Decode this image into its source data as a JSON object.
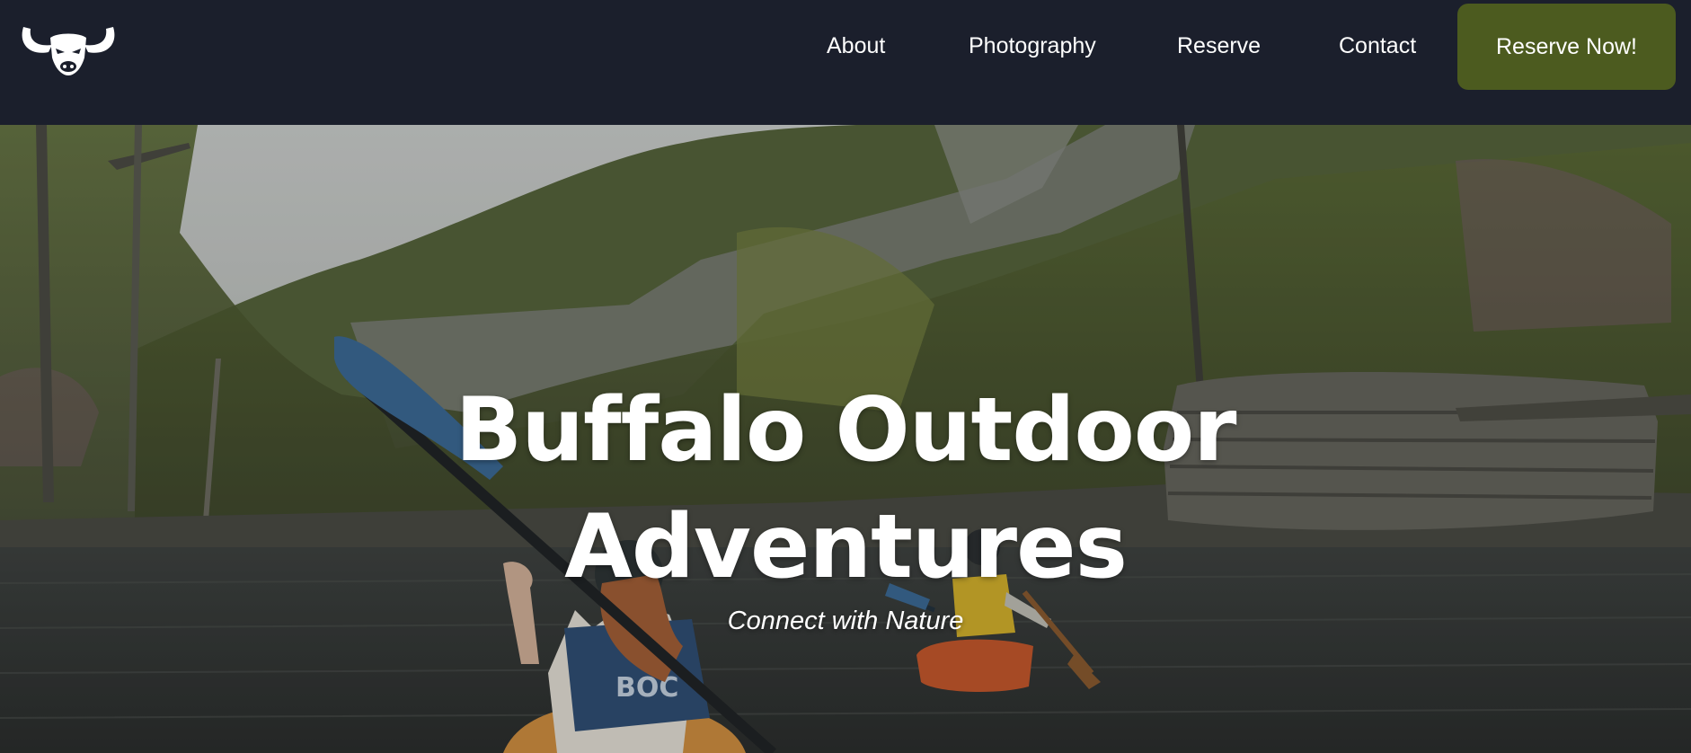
{
  "header": {
    "logo_icon": "buffalo-head-icon",
    "nav": {
      "about": "About",
      "photography": "Photography",
      "reserve": "Reserve",
      "contact": "Contact"
    },
    "cta_label": "Reserve Now!"
  },
  "hero": {
    "title_line1": "Buffalo Outdoor",
    "title_line2": "Adventures",
    "subtitle": "Connect with Nature",
    "kayak_vest_lettering": "BOC"
  },
  "colors": {
    "navbar_bg": "#1b1f2c",
    "cta_bg": "#4c5b1f",
    "text": "#ffffff"
  }
}
